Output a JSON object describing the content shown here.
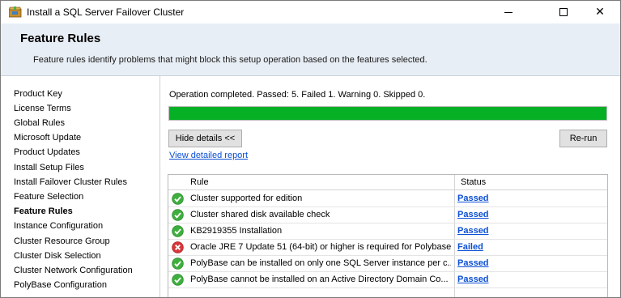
{
  "window": {
    "title": "Install a SQL Server Failover Cluster",
    "minimize_glyph": "",
    "maximize_glyph": "",
    "close_glyph": "✕"
  },
  "header": {
    "title": "Feature Rules",
    "description": "Feature rules identify problems that might block this setup operation based on the features selected."
  },
  "nav": {
    "items": [
      {
        "label": "Product Key",
        "active": false
      },
      {
        "label": "License Terms",
        "active": false
      },
      {
        "label": "Global Rules",
        "active": false
      },
      {
        "label": "Microsoft Update",
        "active": false
      },
      {
        "label": "Product Updates",
        "active": false
      },
      {
        "label": "Install Setup Files",
        "active": false
      },
      {
        "label": "Install Failover Cluster Rules",
        "active": false
      },
      {
        "label": "Feature Selection",
        "active": false
      },
      {
        "label": "Feature Rules",
        "active": true
      },
      {
        "label": "Instance Configuration",
        "active": false
      },
      {
        "label": "Cluster Resource Group",
        "active": false
      },
      {
        "label": "Cluster Disk Selection",
        "active": false
      },
      {
        "label": "Cluster Network Configuration",
        "active": false
      },
      {
        "label": "PolyBase Configuration",
        "active": false
      }
    ]
  },
  "main": {
    "status_text": "Operation completed. Passed: 5.   Failed 1.   Warning 0.   Skipped 0.",
    "progress_fraction": 1.0,
    "progress_color": "#06b025",
    "hide_details_label": "Hide details <<",
    "rerun_label": "Re-run",
    "report_link": "View detailed report"
  },
  "rules_table": {
    "columns": [
      "Rule",
      "Status"
    ],
    "rows": [
      {
        "icon": "success-check-icon",
        "rule": "Cluster supported for edition",
        "status": "Passed"
      },
      {
        "icon": "success-check-icon",
        "rule": "Cluster shared disk available check",
        "status": "Passed"
      },
      {
        "icon": "success-check-icon",
        "rule": "KB2919355 Installation",
        "status": "Passed"
      },
      {
        "icon": "error-x-icon",
        "rule": "Oracle JRE 7 Update 51 (64-bit) or higher is required for Polybase",
        "status": "Failed"
      },
      {
        "icon": "success-check-icon",
        "rule": "PolyBase can be installed on only one SQL Server instance per c...",
        "status": "Passed"
      },
      {
        "icon": "success-check-icon",
        "rule": "PolyBase cannot be installed on an Active Directory Domain Co...",
        "status": "Passed"
      }
    ]
  },
  "colors": {
    "header_bg": "#e8eef5",
    "link": "#0b4fd4",
    "success": "#3fae3f",
    "error": "#d9383a"
  }
}
